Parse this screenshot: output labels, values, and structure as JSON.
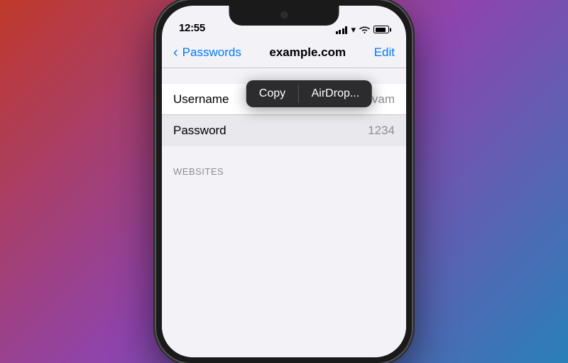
{
  "phone": {
    "status": {
      "time": "12:55",
      "signal_label": "signal",
      "wifi_label": "wifi",
      "battery_label": "battery"
    },
    "nav": {
      "back_label": "Passwords",
      "title": "example.com",
      "edit_label": "Edit"
    },
    "context_menu": {
      "copy_label": "Copy",
      "airdrop_label": "AirDrop..."
    },
    "rows": [
      {
        "label": "Username",
        "value": "shivam"
      },
      {
        "label": "Password",
        "value": "1234"
      }
    ],
    "sections": {
      "websites_label": "WEBSITES"
    }
  }
}
